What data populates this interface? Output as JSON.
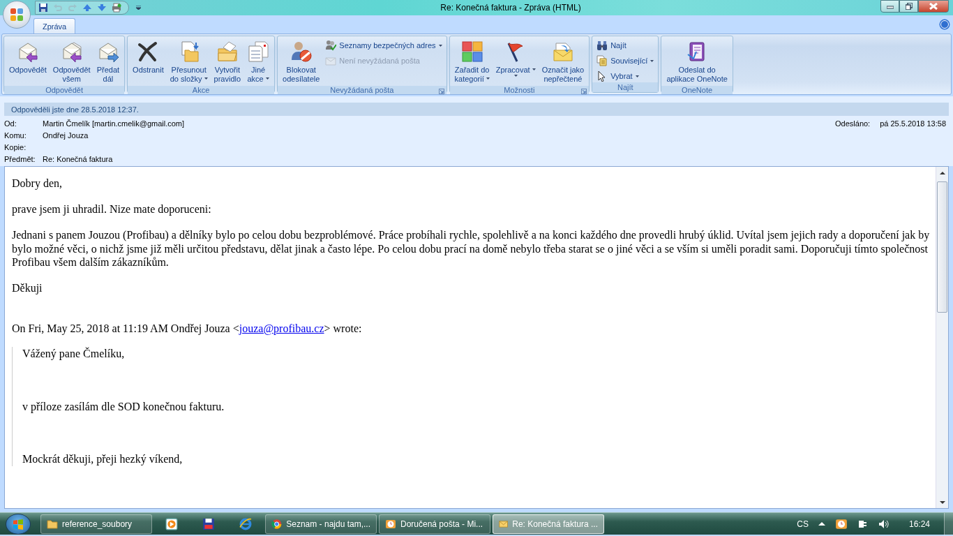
{
  "window": {
    "title": "Re: Konečná faktura - Zpráva (HTML)"
  },
  "quick_access": [
    {
      "disabled": false
    },
    {
      "disabled": true
    },
    {
      "disabled": true
    },
    {
      "disabled": false
    },
    {
      "disabled": false
    },
    {
      "disabled": false
    }
  ],
  "ribbon": {
    "tabs": [
      {
        "label": "Zpráva",
        "selected": true
      }
    ],
    "groups": [
      {
        "label": "Odpovědět",
        "launcher": false,
        "buttons": [
          {
            "kind": "large",
            "label": "Odpovědět",
            "dropdown": false,
            "disabled": false
          },
          {
            "kind": "large",
            "label": "Odpovědět\nvšem",
            "dropdown": false,
            "disabled": false
          },
          {
            "kind": "large",
            "label": "Předat\ndál",
            "dropdown": false,
            "disabled": false
          }
        ]
      },
      {
        "label": "Akce",
        "launcher": false,
        "buttons": [
          {
            "kind": "large",
            "label": "Odstranit",
            "dropdown": false,
            "disabled": false
          },
          {
            "kind": "large",
            "label": "Přesunout\ndo složky",
            "dropdown": true,
            "disabled": false
          },
          {
            "kind": "large",
            "label": "Vytvořit\npravidlo",
            "dropdown": false,
            "disabled": false
          },
          {
            "kind": "large",
            "label": "Jiné\nakce",
            "dropdown": true,
            "disabled": false
          }
        ]
      },
      {
        "label": "Nevyžádaná pošta",
        "launcher": true,
        "buttons": [
          {
            "kind": "large",
            "label": "Blokovat\nodesílatele",
            "dropdown": false,
            "disabled": false
          },
          {
            "kind": "small",
            "label": "Seznamy bezpečných adres",
            "dropdown": true,
            "disabled": false
          },
          {
            "kind": "small",
            "label": "Není nevyžádaná pošta",
            "dropdown": false,
            "disabled": true
          }
        ]
      },
      {
        "label": "Možnosti",
        "launcher": true,
        "buttons": [
          {
            "kind": "large",
            "label": "Zařadit do\nkategorií",
            "dropdown": true,
            "disabled": false
          },
          {
            "kind": "large",
            "label": "Zpracovat",
            "dropdown": true,
            "disabled": false
          },
          {
            "kind": "large",
            "label": "Označit jako\nnepřečtené",
            "dropdown": false,
            "disabled": false
          }
        ]
      },
      {
        "label": "Najít",
        "launcher": false,
        "buttons": [
          {
            "kind": "small",
            "label": "Najít",
            "dropdown": false,
            "disabled": false
          },
          {
            "kind": "small",
            "label": "Související",
            "dropdown": true,
            "disabled": false
          },
          {
            "kind": "small",
            "label": "Vybrat",
            "dropdown": true,
            "disabled": false
          }
        ]
      },
      {
        "label": "OneNote",
        "launcher": false,
        "buttons": [
          {
            "kind": "large",
            "label": "Odeslat do\naplikace OneNote",
            "dropdown": false,
            "disabled": false
          }
        ]
      }
    ]
  },
  "header": {
    "info": "Odpověděli jste dne 28.5.2018 12:37.",
    "fields": [
      {
        "label": "Od:",
        "value": "Martin Čmelík [martin.cmelik@gmail.com]"
      },
      {
        "label": "Komu:",
        "value": "Ondřej Jouza"
      },
      {
        "label": "Kopie:"
      },
      {
        "label": "Předmět:",
        "value": "Re: Konečná faktura"
      }
    ],
    "sent": {
      "label": "Odesláno:",
      "value": "pá 25.5.2018 13:58"
    }
  },
  "body": {
    "paragraphs": [
      "Dobry den,",
      "prave jsem ji uhradil. Nize mate doporuceni:",
      "Jednani s panem Jouzou (Profibau) a dělníky bylo po celou dobu bezproblémové. Práce probíhali rychle, spolehlivě a na konci každého dne provedli hrubý úklid. Uvítal jsem jejich rady a doporučení jak by bylo možné věci, o nichž jsme již měli určitou představu, dělat jinak a často lépe. Po celou dobu prací na domě nebylo třeba starat se o jiné věci a se vším si uměli poradit sami. Doporučuji tímto společnost Profibau všem dalším zákazníkům.",
      "Děkuji"
    ],
    "quote_intro": {
      "before": "On Fri, May 25, 2018 at 11:19 AM Ondřej Jouza <",
      "link": "jouza@profibau.cz",
      "after": "> wrote:"
    },
    "quoted": [
      "Vážený pane Čmelíku,",
      "v příloze zasílám dle SOD konečnou fakturu.",
      "Mockrát děkuji, přeji hezký víkend,"
    ]
  },
  "taskbar": {
    "items": [
      {
        "kind": "window",
        "label": "reference_soubory",
        "selected": false
      },
      {
        "kind": "pinned",
        "selected": false
      },
      {
        "kind": "pinned",
        "selected": false
      },
      {
        "kind": "pinned",
        "selected": false
      },
      {
        "kind": "window",
        "label": "Seznam - najdu tam,...",
        "selected": false
      },
      {
        "kind": "window",
        "label": "Doručená pošta - Mi...",
        "selected": false
      },
      {
        "kind": "window",
        "label": "Re: Konečná faktura ...",
        "selected": true
      }
    ],
    "language": "CS",
    "time": "16:24"
  }
}
